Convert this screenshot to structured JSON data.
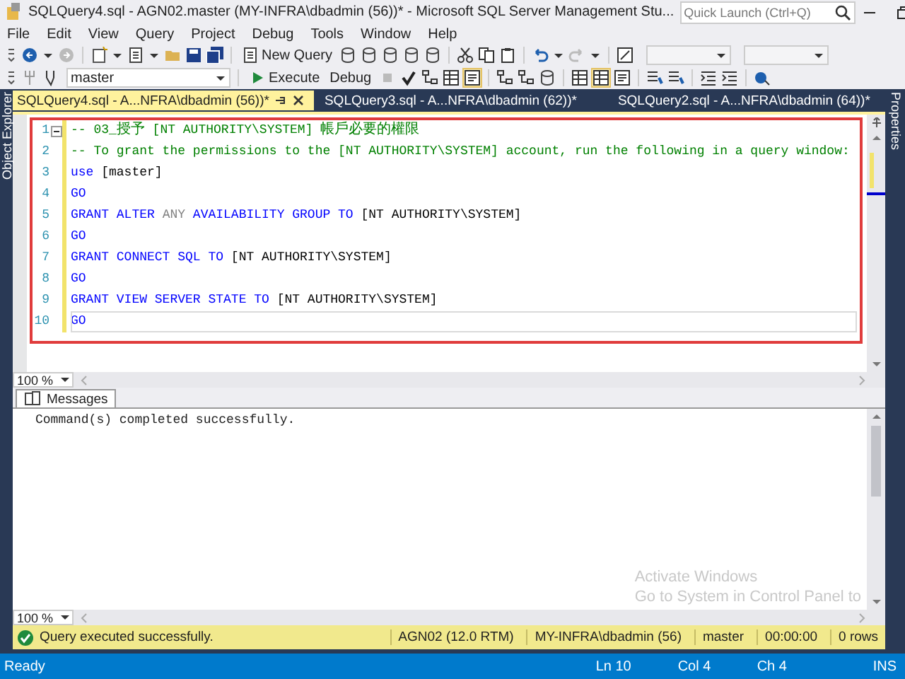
{
  "window": {
    "title": "SQLQuery4.sql - AGN02.master (MY-INFRA\\dbadmin (56))* - Microsoft SQL Server Management Stu...",
    "quick_launch": {
      "placeholder": "Quick Launch (Ctrl+Q)"
    }
  },
  "menu": [
    "File",
    "Edit",
    "View",
    "Query",
    "Project",
    "Debug",
    "Tools",
    "Window",
    "Help"
  ],
  "toolbar": {
    "new_query": "New Query",
    "database": "master",
    "execute": "Execute",
    "debug": "Debug"
  },
  "side_panels": {
    "left": "Object Explorer",
    "right": "Properties"
  },
  "tabs": [
    {
      "label": "SQLQuery4.sql - A...NFRA\\dbadmin (56))*",
      "selected": true
    },
    {
      "label": "SQLQuery3.sql - A...NFRA\\dbadmin (62))*",
      "selected": false
    },
    {
      "label": "SQLQuery2.sql - A...NFRA\\dbadmin (64))*",
      "selected": false
    }
  ],
  "editor": {
    "zoom": "100 %",
    "lines": [
      {
        "number": "1",
        "current": false,
        "tokens": [
          {
            "kind": "comment",
            "text": "-- 03_授予 [NT AUTHORITY\\SYSTEM] 帳戶必要的權限"
          }
        ]
      },
      {
        "number": "2",
        "current": false,
        "tokens": [
          {
            "kind": "comment",
            "text": "-- To grant the permissions to the [NT AUTHORITY\\SYSTEM] account, run the following in a query window:"
          }
        ]
      },
      {
        "number": "3",
        "current": false,
        "tokens": [
          {
            "kind": "keyword",
            "text": "use"
          },
          {
            "kind": "plain",
            "text": " [master]"
          }
        ]
      },
      {
        "number": "4",
        "current": false,
        "tokens": [
          {
            "kind": "keyword",
            "text": "GO"
          }
        ]
      },
      {
        "number": "5",
        "current": false,
        "tokens": [
          {
            "kind": "keyword",
            "text": "GRANT ALTER "
          },
          {
            "kind": "system",
            "text": "ANY"
          },
          {
            "kind": "keyword",
            "text": " AVAILABILITY GROUP TO "
          },
          {
            "kind": "plain",
            "text": "[NT AUTHORITY\\SYSTEM]"
          }
        ]
      },
      {
        "number": "6",
        "current": false,
        "tokens": [
          {
            "kind": "keyword",
            "text": "GO"
          }
        ]
      },
      {
        "number": "7",
        "current": false,
        "tokens": [
          {
            "kind": "keyword",
            "text": "GRANT CONNECT SQL TO "
          },
          {
            "kind": "plain",
            "text": "[NT AUTHORITY\\SYSTEM]"
          }
        ]
      },
      {
        "number": "8",
        "current": false,
        "tokens": [
          {
            "kind": "keyword",
            "text": "GO"
          }
        ]
      },
      {
        "number": "9",
        "current": false,
        "tokens": [
          {
            "kind": "keyword",
            "text": "GRANT VIEW SERVER STATE TO "
          },
          {
            "kind": "plain",
            "text": "[NT AUTHORITY\\SYSTEM]"
          }
        ]
      },
      {
        "number": "10",
        "current": true,
        "tokens": [
          {
            "kind": "keyword",
            "text": "GO"
          }
        ]
      }
    ]
  },
  "messages": {
    "tab": "Messages",
    "text": "Command(s) completed successfully.",
    "zoom": "100 %"
  },
  "os_notice": [
    "Activate Windows",
    "Go to System in Control Panel to"
  ],
  "query_status": {
    "message": "Query executed successfully.",
    "server": "AGN02 (12.0 RTM)",
    "login": "MY-INFRA\\dbadmin (56)",
    "database": "master",
    "elapsed": "00:00:00",
    "rows": "0 rows"
  },
  "status_bar": {
    "state": "Ready",
    "line": "Ln 10",
    "column": "Col 4",
    "char": "Ch 4",
    "mode": "INS"
  }
}
